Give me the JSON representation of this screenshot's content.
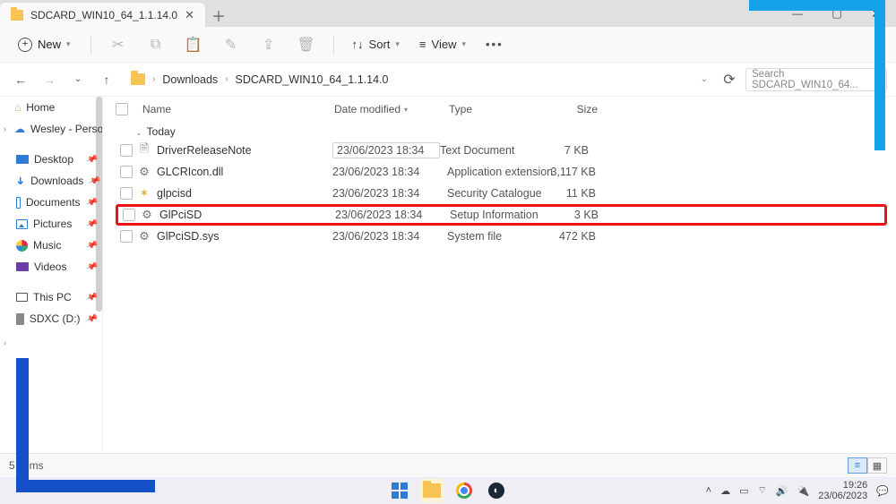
{
  "window": {
    "tab_title": "SDCARD_WIN10_64_1.1.14.0"
  },
  "toolbar": {
    "new_label": "New",
    "sort_label": "Sort",
    "view_label": "View"
  },
  "breadcrumbs": {
    "item1": "Downloads",
    "item2": "SDCARD_WIN10_64_1.1.14.0"
  },
  "search": {
    "placeholder": "Search SDCARD_WIN10_64..."
  },
  "sidebar": {
    "home": "Home",
    "onedrive": "Wesley - Personal",
    "desktop": "Desktop",
    "downloads": "Downloads",
    "documents": "Documents",
    "pictures": "Pictures",
    "music": "Music",
    "videos": "Videos",
    "thispc": "This PC",
    "sdxc": "SDXC (D:)"
  },
  "columns": {
    "name": "Name",
    "date": "Date modified",
    "type": "Type",
    "size": "Size"
  },
  "group_today": "Today",
  "files": [
    {
      "name": "DriverReleaseNote",
      "date": "23/06/2023 18:34",
      "type": "Text Document",
      "size": "7 KB"
    },
    {
      "name": "GLCRIcon.dll",
      "date": "23/06/2023 18:34",
      "type": "Application extension",
      "size": "3,117 KB"
    },
    {
      "name": "glpcisd",
      "date": "23/06/2023 18:34",
      "type": "Security Catalogue",
      "size": "11 KB"
    },
    {
      "name": "GlPciSD",
      "date": "23/06/2023 18:34",
      "type": "Setup Information",
      "size": "3 KB"
    },
    {
      "name": "GlPciSD.sys",
      "date": "23/06/2023 18:34",
      "type": "System file",
      "size": "472 KB"
    }
  ],
  "status": {
    "count": "5 items"
  },
  "tray": {
    "time": "19:26",
    "date": "23/06/2023"
  }
}
